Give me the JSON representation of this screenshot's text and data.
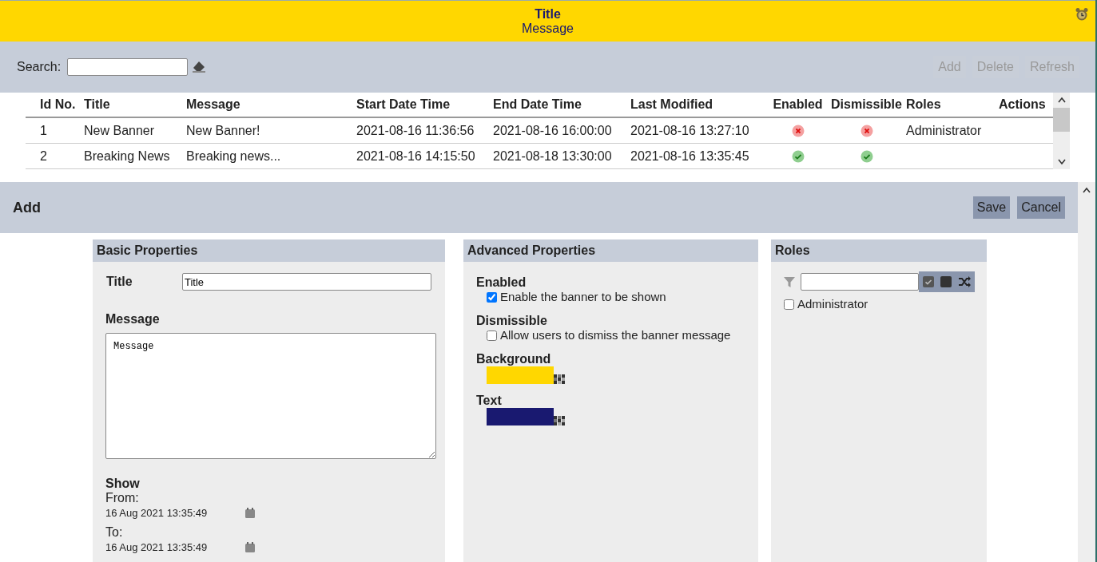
{
  "banner": {
    "title": "Title",
    "message": "Message"
  },
  "toolbar": {
    "search_label": "Search:",
    "buttons": [
      {
        "label": "Add",
        "disabled": true
      },
      {
        "label": "Delete",
        "disabled": true
      },
      {
        "label": "Refresh",
        "disabled": true
      }
    ]
  },
  "table": {
    "columns": [
      "Id No.",
      "Title",
      "Message",
      "Start Date Time",
      "End Date Time",
      "Last Modified",
      "Enabled",
      "Dismissible",
      "Roles",
      "Actions"
    ],
    "rows": [
      {
        "id": "1",
        "title": "New Banner",
        "message": "New Banner!",
        "start": "2021-08-16 11:36:56",
        "end": "2021-08-16 16:00:00",
        "modified": "2021-08-16 13:27:10",
        "enabled": false,
        "dismissible": false,
        "roles": "Administrator"
      },
      {
        "id": "2",
        "title": "Breaking News",
        "message": "Breaking news...",
        "start": "2021-08-16 14:15:50",
        "end": "2021-08-18 13:30:00",
        "modified": "2021-08-16 13:35:45",
        "enabled": true,
        "dismissible": true
      }
    ]
  },
  "editor": {
    "heading": "Add",
    "buttons": [
      "Save",
      "Cancel"
    ],
    "basic": {
      "heading": "Basic Properties",
      "title_label": "Title",
      "title_value": "Title",
      "message_label": "Message",
      "message_value": "Message",
      "show_label": "Show",
      "from_label": "From:",
      "from_value": "16 Aug 2021 13:35:49",
      "to_label": "To:",
      "to_value": "16 Aug 2021 13:35:49"
    },
    "advanced": {
      "heading": "Advanced Properties",
      "enabled_label": "Enabled",
      "enabled_option": {
        "label": "Enable the banner to be shown",
        "checked": true
      },
      "dismissible_label": "Dismissible",
      "dismissible_option": {
        "label": "Allow users to dismiss the banner message",
        "checked": false
      },
      "swatches": [
        {
          "label": "Background",
          "color": "#ffd700"
        },
        {
          "label": "Text",
          "color": "#191970"
        }
      ]
    },
    "roles": {
      "heading": "Roles",
      "items": [
        {
          "label": "Administrator",
          "checked": false
        }
      ]
    }
  }
}
